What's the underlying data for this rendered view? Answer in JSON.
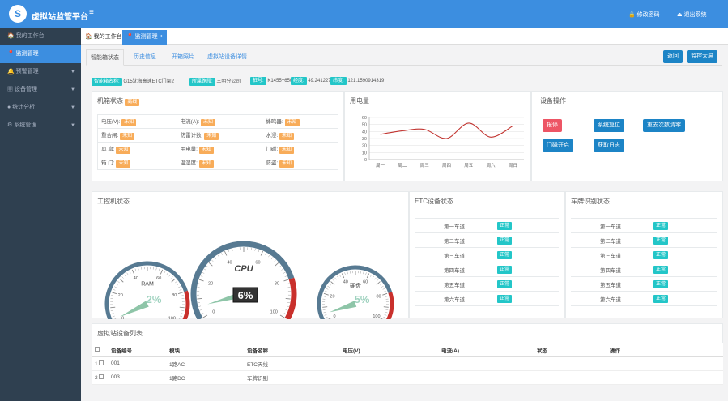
{
  "app": {
    "title": "虚拟站监管平台",
    "password_label": "修改密码",
    "logout_label": "退出系统",
    "logo": "S",
    "menu_icon": "≡"
  },
  "sidebar": {
    "items": [
      {
        "icon": "🏠",
        "label": "我的工作台",
        "has_arrow": false
      },
      {
        "icon": "📍",
        "label": "监测管理",
        "has_arrow": false,
        "active": true
      },
      {
        "icon": "🔔",
        "label": "预警管理",
        "has_arrow": true
      },
      {
        "icon": "▦",
        "label": "设备管理",
        "has_arrow": true
      },
      {
        "icon": "●",
        "label": "统计分析",
        "has_arrow": true
      },
      {
        "icon": "⚙",
        "label": "系统管理",
        "has_arrow": true
      }
    ]
  },
  "page_tabs": [
    {
      "label": "我的工作台",
      "icon": "🏠"
    },
    {
      "label": "监测管理",
      "icon": "📍",
      "close": "×"
    }
  ],
  "subtabs": [
    "智能箱状态",
    "历史信息",
    "开箱照片",
    "虚拟站设备详情"
  ],
  "buttons": {
    "back": "返回",
    "monitor_screen": "监控大屏"
  },
  "info": [
    {
      "key": "智能箱名称:",
      "value": "G15沈海高速ETC门架2"
    },
    {
      "key": "所属路段:",
      "value": "三明分公司"
    },
    {
      "key": "桩号:",
      "value": "K1455+650"
    },
    {
      "key": "经度:",
      "value": "49.2412273238"
    },
    {
      "key": "纬度:",
      "value": "121.1590914319"
    }
  ],
  "cabinet": {
    "title": "机箱状态",
    "badge": "离线",
    "rows": [
      [
        {
          "label": "电压(V):",
          "val": "未知"
        },
        {
          "label": "电流(A):",
          "val": "未知"
        },
        {
          "label": "蜂鸣器:",
          "val": "未知"
        }
      ],
      [
        {
          "label": "重合闸:",
          "val": "未知"
        },
        {
          "label": "防雷计数:",
          "val": "未知"
        },
        {
          "label": "水浸:",
          "val": "未知"
        }
      ],
      [
        {
          "label": "风    扇:",
          "val": "未知"
        },
        {
          "label": "用电量:",
          "val": "未知"
        },
        {
          "label": "门磁:",
          "val": "未知"
        }
      ],
      [
        {
          "label": "箱    门:",
          "val": "未知"
        },
        {
          "label": "温湿度:",
          "val": "未知"
        },
        {
          "label": "防盗:",
          "val": "未知"
        }
      ]
    ]
  },
  "power_panel": {
    "title": "用电量"
  },
  "chart_data": {
    "type": "line",
    "categories": [
      "周一",
      "周二",
      "周三",
      "周四",
      "周五",
      "周六",
      "周日"
    ],
    "series": [
      {
        "values": [
          36,
          41,
          43,
          30,
          52,
          32,
          48
        ]
      }
    ],
    "ylim": [
      0,
      60
    ],
    "yticks": [
      0,
      10,
      20,
      30,
      40,
      50,
      60
    ],
    "grid": true
  },
  "device_ops": {
    "title": "设备操作",
    "buttons": [
      {
        "label": "报停",
        "color": "red"
      },
      {
        "label": "系统复位",
        "color": "blue"
      },
      {
        "label": "重去次数清零",
        "color": "blue"
      },
      {
        "label": "门磁开启",
        "color": "blue"
      },
      {
        "label": "获取日志",
        "color": "blue"
      }
    ]
  },
  "ipc": {
    "title": "工控机状态",
    "gauges": [
      {
        "name": "RAM",
        "value": 2,
        "text": "2%"
      },
      {
        "name": "CPU",
        "value": 6,
        "text": "6%"
      },
      {
        "name": "硬盘",
        "value": 5,
        "text": "5%"
      }
    ],
    "scale_labels": [
      "0",
      "20",
      "40",
      "60",
      "80",
      "100"
    ]
  },
  "etc": {
    "title": "ETC设备状态",
    "lanes": [
      "第一车道",
      "第二车道",
      "第三车道",
      "第四车道",
      "第五车道",
      "第六车道"
    ],
    "status": "正常"
  },
  "plate": {
    "title": "车牌识别状态",
    "lanes": [
      "第一车道",
      "第二车道",
      "第三车道",
      "第四车道",
      "第五车道",
      "第六车道"
    ],
    "status": "正常"
  },
  "vtable": {
    "title": "虚拟站设备列表",
    "headers": [
      "",
      "设备编号",
      "模块",
      "设备名称",
      "电压(V)",
      "电流(A)",
      "状态",
      "操作"
    ],
    "rows": [
      {
        "idx": "1",
        "code": "001",
        "module": "1路AC",
        "name": "ETC天线"
      },
      {
        "idx": "2",
        "code": "003",
        "module": "1路DC",
        "name": "车牌识别"
      }
    ]
  },
  "colors": {
    "topbar": "#3c8ee0",
    "sidebar": "#2f4050",
    "label": "#23c6c8",
    "warn": "#f8ac59",
    "danger": "#ed5565",
    "gauge_arc": "#577a92",
    "gauge_red": "#c9302c",
    "gauge_value": "#9fd2bf"
  }
}
